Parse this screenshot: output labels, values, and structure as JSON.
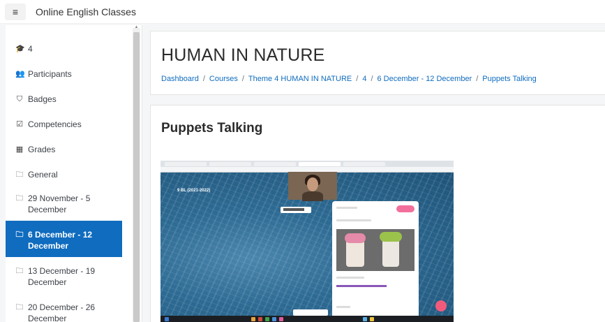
{
  "navbar": {
    "menu_icon": "hamburger-icon",
    "site_name": "Online English Classes"
  },
  "drawer": {
    "items": [
      {
        "icon": "graduation-cap-icon",
        "glyph": "🎓",
        "label": "4",
        "active": false
      },
      {
        "icon": "users-icon",
        "glyph": "👥",
        "label": "Participants",
        "active": false
      },
      {
        "icon": "shield-icon",
        "glyph": "⛉",
        "label": "Badges",
        "active": false
      },
      {
        "icon": "check-square-icon",
        "glyph": "☑",
        "label": "Competencies",
        "active": false
      },
      {
        "icon": "table-icon",
        "glyph": "▦",
        "label": "Grades",
        "active": false
      },
      {
        "icon": "folder-icon",
        "glyph": "🗀",
        "label": "General",
        "active": false
      },
      {
        "icon": "folder-icon",
        "glyph": "🗀",
        "label": "29 November - 5 December",
        "active": false
      },
      {
        "icon": "folder-icon",
        "glyph": "🗀",
        "label": "6 December - 12 December",
        "active": true
      },
      {
        "icon": "folder-icon",
        "glyph": "🗀",
        "label": "13 December - 19 December",
        "active": false
      },
      {
        "icon": "folder-icon",
        "glyph": "🗀",
        "label": "20 December - 26 December",
        "active": false
      }
    ]
  },
  "header": {
    "title": "HUMAN IN NATURE",
    "breadcrumb": [
      "Dashboard",
      "Courses",
      "Theme 4 HUMAN IN NATURE",
      "4",
      "6 December - 12 December",
      "Puppets Talking"
    ],
    "separator": "/"
  },
  "content": {
    "title": "Puppets Talking",
    "embedded_image": "classroom-screenshot",
    "embedded_room_title": "9 BL (2021-2022)"
  },
  "colors": {
    "accent": "#0f6cbf",
    "active_bg": "#0f6cbf",
    "pink": "#f36f9b"
  }
}
